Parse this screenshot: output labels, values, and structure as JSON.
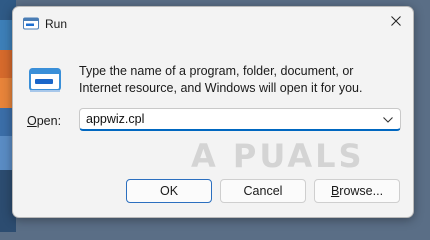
{
  "window": {
    "title": "Run",
    "close_icon": "close-icon",
    "app_icon": "run-app-icon"
  },
  "content": {
    "description": "Type the name of a program, folder, document, or Internet resource, and Windows will open it for you.",
    "open_label_accel": "O",
    "open_label_rest": "pen:",
    "open_value": "appwiz.cpl",
    "dropdown_icon": "chevron-down-icon"
  },
  "buttons": {
    "ok": "OK",
    "cancel": "Cancel",
    "browse_accel": "B",
    "browse_rest": "rowse..."
  },
  "watermark": "A PUALS",
  "colors": {
    "accent": "#0067c0",
    "dialog_bg": "#f3f3f3"
  }
}
